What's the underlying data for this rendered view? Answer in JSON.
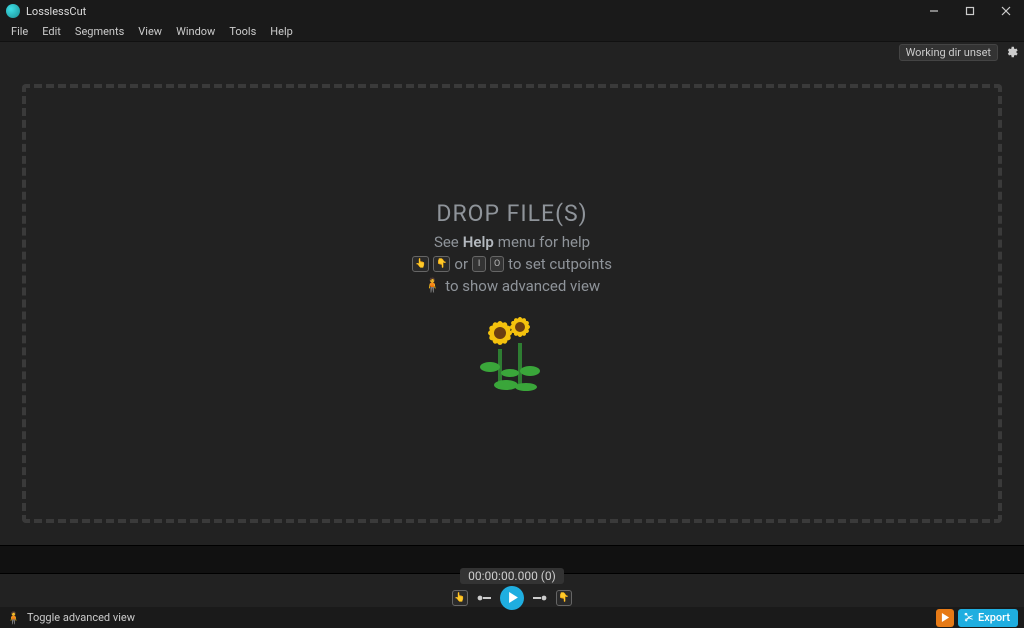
{
  "titlebar": {
    "app_name": "LosslessCut"
  },
  "menu": {
    "items": [
      "File",
      "Edit",
      "Segments",
      "View",
      "Window",
      "Tools",
      "Help"
    ]
  },
  "toprow": {
    "working_dir": "Working dir unset"
  },
  "dropzone": {
    "title": "DROP FILE(S)",
    "line1_pre": "See ",
    "line1_bold": "Help",
    "line1_post": " menu for help",
    "line2_or": "or",
    "line2_tail": "to set cutpoints",
    "line3": "to show advanced view",
    "keys": {
      "i_label": "I",
      "o_label": "O"
    }
  },
  "timecode": "00:00:00.000 (0)",
  "bottombar": {
    "toggle_label": "Toggle advanced view",
    "export_label": "Export"
  }
}
